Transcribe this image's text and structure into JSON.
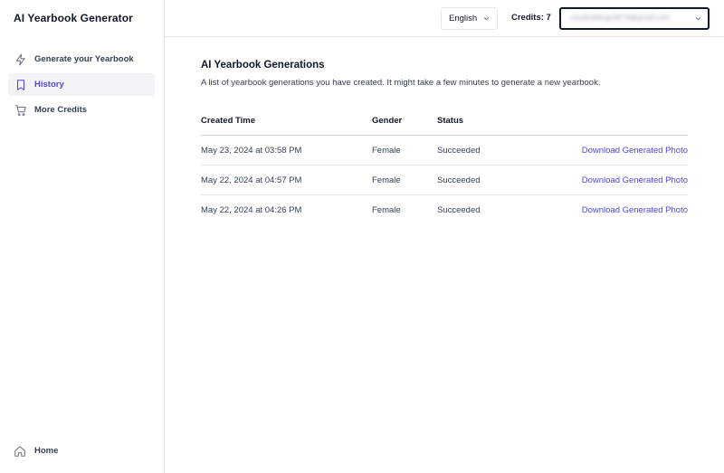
{
  "app": {
    "title": "AI Yearbook Generator"
  },
  "sidebar": {
    "items": [
      {
        "label": "Generate your Yearbook",
        "icon": "lightning-icon"
      },
      {
        "label": "History",
        "icon": "bookmark-icon",
        "active": true
      },
      {
        "label": "More Credits",
        "icon": "cart-icon"
      }
    ],
    "footer": {
      "label": "Home",
      "icon": "home-icon"
    }
  },
  "header": {
    "language": "English",
    "credits": "Credits: 7",
    "account_email": "carolinebingo0574@gmail.com"
  },
  "main": {
    "title": "AI Yearbook Generations",
    "description": "A list of yearbook generations you have created. It might take a few minutes to generate a new yearbook.",
    "table": {
      "columns": [
        "Created Time",
        "Gender",
        "Status",
        ""
      ],
      "rows": [
        {
          "time": "May 23, 2024 at 03:58 PM",
          "gender": "Female",
          "status": "Succeeded",
          "action": "Download Generated Photo"
        },
        {
          "time": "May 22, 2024 at 04:57 PM",
          "gender": "Female",
          "status": "Succeeded",
          "action": "Download Generated Photo"
        },
        {
          "time": "May 22, 2024 at 04:26 PM",
          "gender": "Female",
          "status": "Succeeded",
          "action": "Download Generated Photo"
        }
      ]
    }
  },
  "colors": {
    "accent": "#4f46e5",
    "text": "#111827",
    "border": "#e5e7eb"
  }
}
